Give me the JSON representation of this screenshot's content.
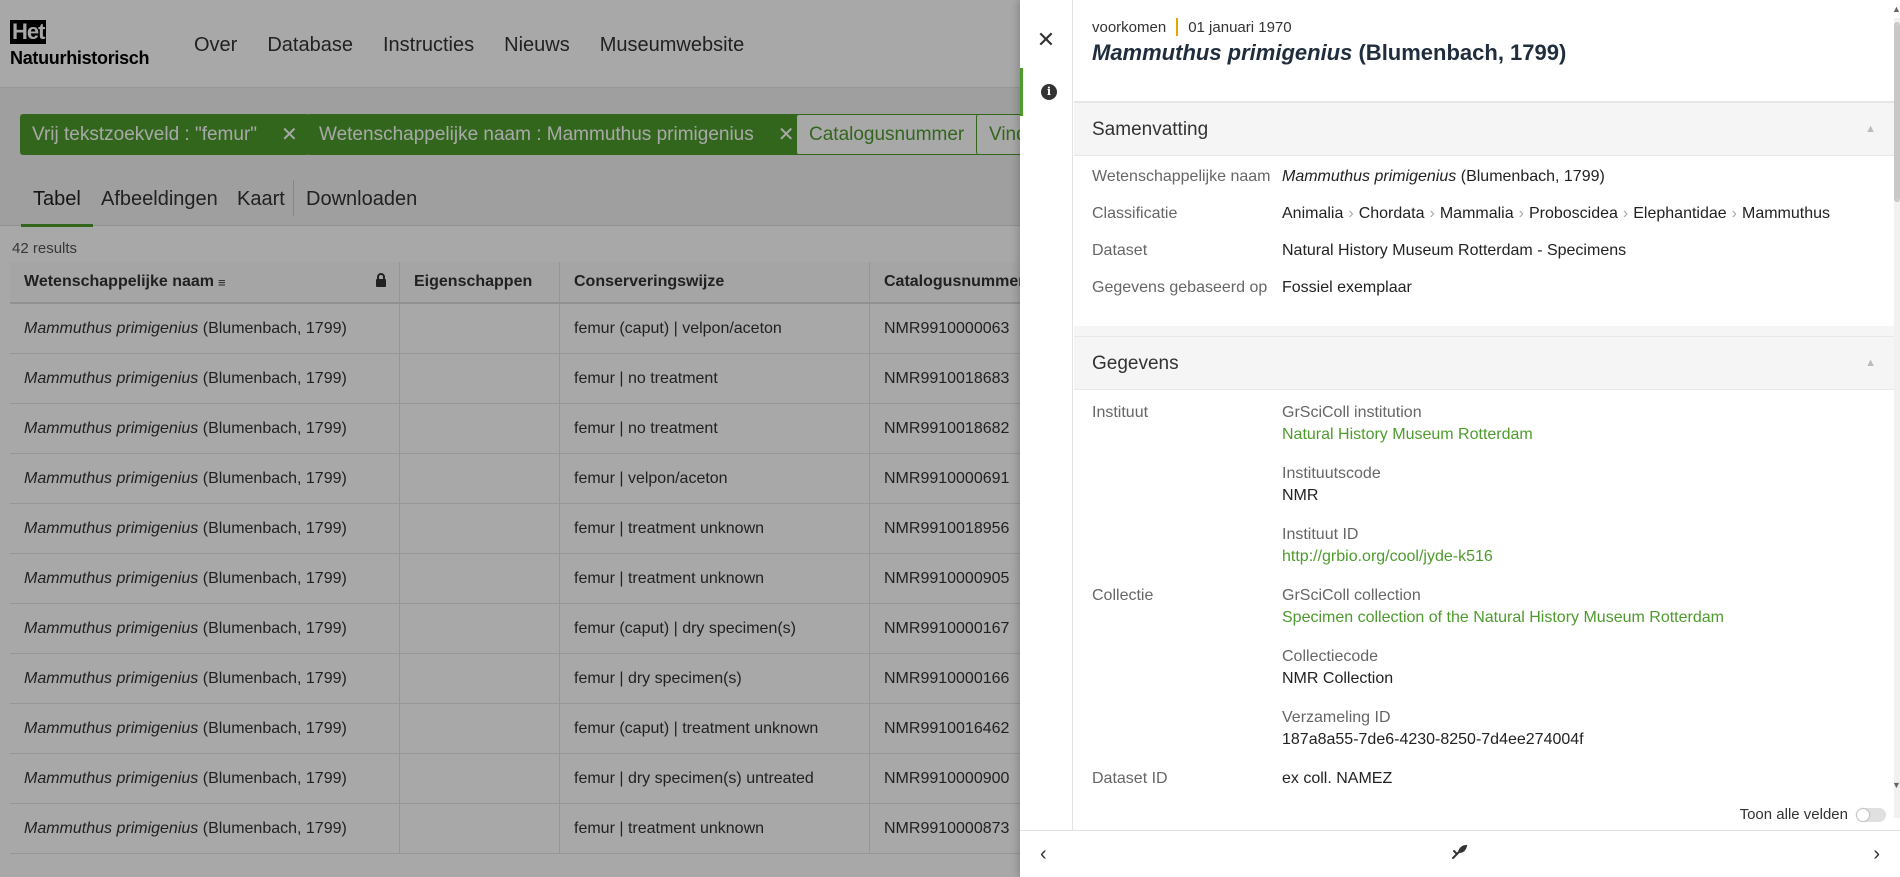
{
  "brand": {
    "logo_top": "Het",
    "logo_word": "Natuurhistorisch"
  },
  "nav": [
    "Over",
    "Database",
    "Instructies",
    "Nieuws",
    "Museumwebsite"
  ],
  "filters": [
    {
      "label": "Vrij tekstzoekveld : \"femur\"",
      "active": true
    },
    {
      "label": "Wetenschappelijke naam : Mammuthus primigenius",
      "active": true
    },
    {
      "label": "Catalogusnummer",
      "active": false
    },
    {
      "label": "Vind",
      "active": false
    }
  ],
  "tabs": [
    "Tabel",
    "Afbeeldingen",
    "Kaart",
    "Downloaden"
  ],
  "results_count": "42 results",
  "table": {
    "columns": [
      "Wetenschappelijke naam",
      "Eigenschappen",
      "Conserveringswijze",
      "Catalogusnummer"
    ],
    "species": "Mammuthus primigenius",
    "author": "(Blumenbach, 1799)",
    "rows": [
      {
        "conservation": "femur (caput) | velpon/aceton",
        "catalog": "NMR9910000063"
      },
      {
        "conservation": "femur | no treatment",
        "catalog": "NMR9910018683"
      },
      {
        "conservation": "femur | no treatment",
        "catalog": "NMR9910018682"
      },
      {
        "conservation": "femur | velpon/aceton",
        "catalog": "NMR9910000691"
      },
      {
        "conservation": "femur | treatment unknown",
        "catalog": "NMR9910018956"
      },
      {
        "conservation": "femur | treatment unknown",
        "catalog": "NMR9910000905"
      },
      {
        "conservation": "femur (caput) | dry specimen(s)",
        "catalog": "NMR9910000167"
      },
      {
        "conservation": "femur | dry specimen(s)",
        "catalog": "NMR9910000166"
      },
      {
        "conservation": "femur (caput) | treatment unknown",
        "catalog": "NMR9910016462"
      },
      {
        "conservation": "femur | dry specimen(s) untreated",
        "catalog": "NMR9910000900"
      },
      {
        "conservation": "femur | treatment unknown",
        "catalog": "NMR9910000873"
      }
    ]
  },
  "drawer": {
    "type": "voorkomen",
    "date": "01 januari 1970",
    "title_species": "Mammuthus primigenius",
    "title_author": "(Blumenbach, 1799)",
    "summary": {
      "heading": "Samenvatting",
      "sci_label": "Wetenschappelijke naam",
      "sci_species": "Mammuthus primigenius",
      "sci_author": "(Blumenbach, 1799)",
      "class_label": "Classificatie",
      "classification": [
        "Animalia",
        "Chordata",
        "Mammalia",
        "Proboscidea",
        "Elephantidae",
        "Mammuthus"
      ],
      "dataset_label": "Dataset",
      "dataset": "Natural History Museum Rotterdam - Specimens",
      "basis_label": "Gegevens gebaseerd op",
      "basis": "Fossiel exemplaar"
    },
    "data": {
      "heading": "Gegevens",
      "institute_label": "Instituut",
      "grsci_inst_label": "GrSciColl institution",
      "grsci_inst": "Natural History Museum Rotterdam",
      "inst_code_label": "Instituutscode",
      "inst_code": "NMR",
      "inst_id_label": "Instituut ID",
      "inst_id": "http://grbio.org/cool/jyde-k516",
      "collection_label": "Collectie",
      "grsci_coll_label": "GrSciColl collection",
      "grsci_coll": "Specimen collection of the Natural History Museum Rotterdam",
      "coll_code_label": "Collectiecode",
      "coll_code": "NMR Collection",
      "coll_id_label": "Verzameling ID",
      "coll_id": "187a8a55-7de6-4230-8250-7d4ee274004f",
      "dataset_id_label": "Dataset ID",
      "dataset_id": "ex coll. NAMEZ"
    },
    "toggle_label": "Toon alle velden"
  },
  "colors": {
    "accent": "#4e9b2d",
    "meta_sep": "#e8a400"
  }
}
